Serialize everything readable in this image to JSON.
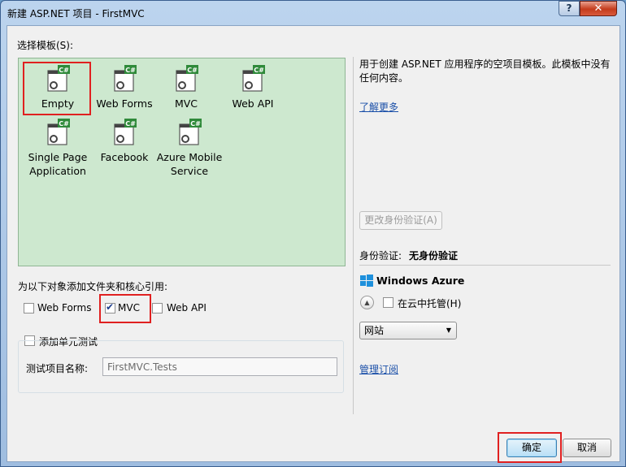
{
  "window": {
    "title": "新建 ASP.NET 项目 - FirstMVC",
    "help_label": "?",
    "close_label": "✕"
  },
  "templates": {
    "label": "选择模板(S):",
    "items": [
      {
        "label": "Empty"
      },
      {
        "label": "Web Forms"
      },
      {
        "label": "MVC"
      },
      {
        "label": "Web API"
      },
      {
        "label_line1": "Single Page",
        "label_line2": "Application"
      },
      {
        "label": "Facebook"
      },
      {
        "label_line1": "Azure Mobile",
        "label_line2": "Service"
      }
    ],
    "icon_badge": "C#"
  },
  "description": {
    "text_line1": "用于创建 ASP.NET 应用程序的空项目模板。此模板中没有",
    "text_line2": "任何内容。",
    "learn_more": "了解更多"
  },
  "auth": {
    "change_button": "更改身份验证(A)",
    "label": "身份验证:",
    "value": "无身份验证"
  },
  "azure": {
    "heading": "Windows Azure",
    "host_label": "在云中托管(H)",
    "host_checked": false,
    "site_option": "网站",
    "manage_link": "管理订阅"
  },
  "references": {
    "label": "为以下对象添加文件夹和核心引用:",
    "options": [
      {
        "label": "Web Forms",
        "checked": false
      },
      {
        "label": "MVC",
        "checked": true
      },
      {
        "label": "Web API",
        "checked": false
      }
    ]
  },
  "unit_test": {
    "label": "添加单元测试",
    "checked": false,
    "project_name_label": "测试项目名称:",
    "project_name_value": "FirstMVC.Tests"
  },
  "footer": {
    "ok": "确定",
    "cancel": "取消"
  }
}
